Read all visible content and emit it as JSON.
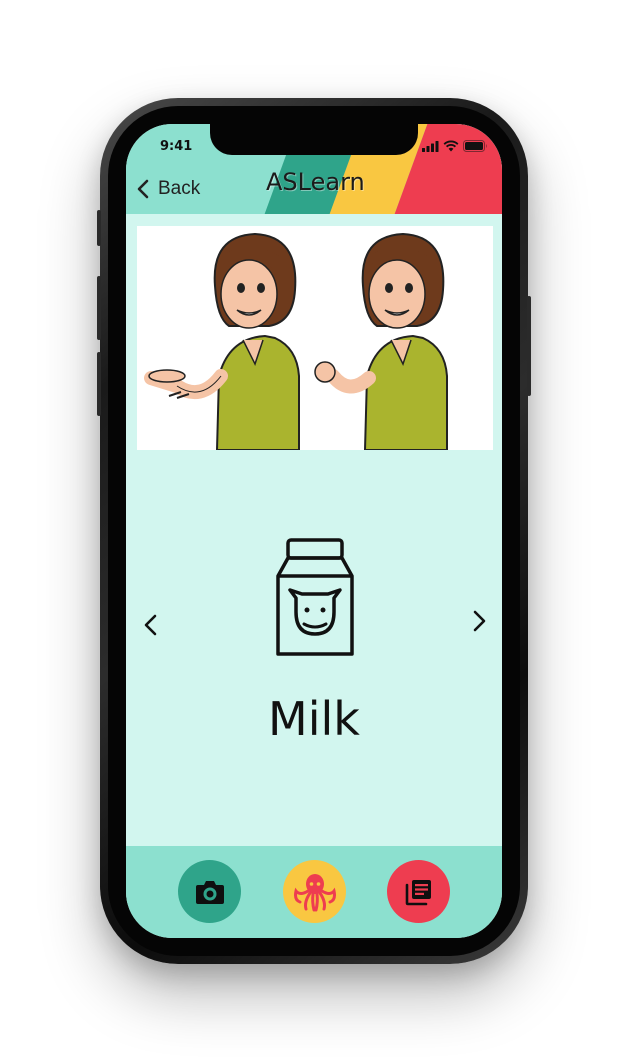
{
  "status_bar": {
    "time": "9:41"
  },
  "header": {
    "back_label": "Back",
    "logo_text": "ASLearn",
    "colors": {
      "background": "#8ce0cf",
      "teal": "#2fa48a",
      "yellow": "#f9c741",
      "red": "#ee3d50"
    }
  },
  "card": {
    "word": "Milk",
    "icon": "milk-carton-icon",
    "image": "asl-sign-illustration",
    "background": "#d2f6ef"
  },
  "navigation": {
    "prev_icon": "chevron-left-icon",
    "next_icon": "chevron-right-icon"
  },
  "tab_bar": {
    "items": [
      {
        "icon": "camera-icon",
        "color": "#2fa48a"
      },
      {
        "icon": "octopus-icon",
        "color": "#f9c741"
      },
      {
        "icon": "flashcards-icon",
        "color": "#ee3d50"
      }
    ]
  }
}
